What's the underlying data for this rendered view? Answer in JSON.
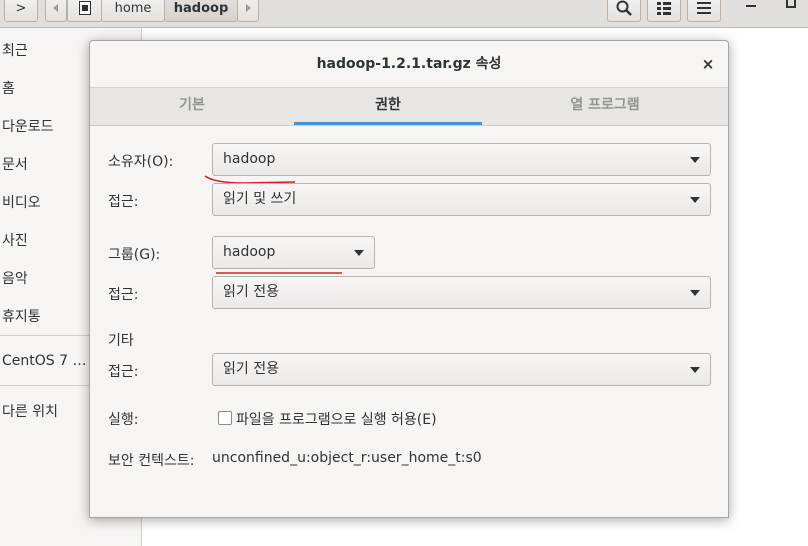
{
  "file_manager": {
    "header": {
      "back_glyph": ">",
      "crumbs": [
        "home",
        "hadoop"
      ]
    },
    "sidebar": {
      "items": [
        "최근",
        "홈",
        "다운로드",
        "문서",
        "비디오",
        "사진",
        "음악",
        "휴지통",
        "CentOS 7 …",
        "다른 위치"
      ]
    }
  },
  "dialog": {
    "title": "hadoop-1.2.1.tar.gz 속성",
    "close_glyph": "×",
    "tabs": [
      {
        "label": "기본",
        "active": false
      },
      {
        "label": "권한",
        "active": true
      },
      {
        "label": "열 프로그램",
        "active": false
      }
    ],
    "owner": {
      "label": "소유자(O):",
      "value": "hadoop"
    },
    "owner_access": {
      "label": "접근:",
      "value": "읽기 및 쓰기"
    },
    "group": {
      "label": "그룹(G):",
      "value": "hadoop"
    },
    "group_access": {
      "label": "접근:",
      "value": "읽기 전용"
    },
    "others": {
      "heading": "기타",
      "label": "접근:",
      "value": "읽기 전용"
    },
    "execute": {
      "label": "실행:",
      "checkbox_label": "파일을 프로그램으로 실행 허용(E)",
      "checked": false
    },
    "security": {
      "label": "보안 컨텍스트:",
      "value": "unconfined_u:object_r:user_home_t:s0"
    }
  },
  "colors": {
    "tab_indicator": "#4a90d9",
    "annotation": "#d9202a"
  }
}
